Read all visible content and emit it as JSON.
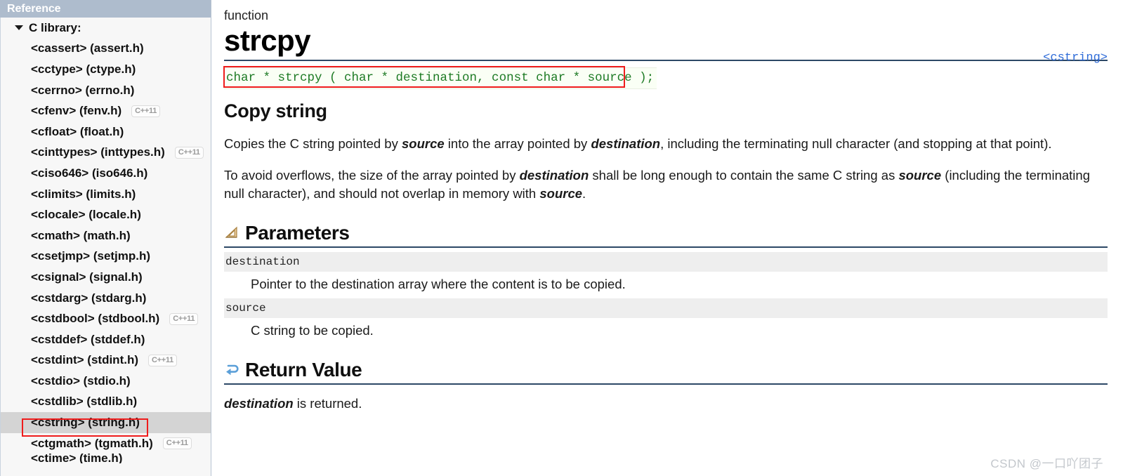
{
  "sidebar": {
    "header": "Reference",
    "annotation_color": "#ef1c1c",
    "selected_bg": "#d4d4d4",
    "header_bg": "#aebccd",
    "root": {
      "label": "C library:",
      "icon": "triangle-down-icon"
    },
    "items": [
      {
        "label": "<cassert> (assert.h)",
        "badge": "",
        "selected": false
      },
      {
        "label": "<cctype> (ctype.h)",
        "badge": "",
        "selected": false
      },
      {
        "label": "<cerrno> (errno.h)",
        "badge": "",
        "selected": false
      },
      {
        "label": "<cfenv> (fenv.h)",
        "badge": "C++11",
        "selected": false
      },
      {
        "label": "<cfloat> (float.h)",
        "badge": "",
        "selected": false
      },
      {
        "label": "<cinttypes> (inttypes.h)",
        "badge": "C++11",
        "selected": false
      },
      {
        "label": "<ciso646> (iso646.h)",
        "badge": "",
        "selected": false
      },
      {
        "label": "<climits> (limits.h)",
        "badge": "",
        "selected": false
      },
      {
        "label": "<clocale> (locale.h)",
        "badge": "",
        "selected": false
      },
      {
        "label": "<cmath> (math.h)",
        "badge": "",
        "selected": false
      },
      {
        "label": "<csetjmp> (setjmp.h)",
        "badge": "",
        "selected": false
      },
      {
        "label": "<csignal> (signal.h)",
        "badge": "",
        "selected": false
      },
      {
        "label": "<cstdarg> (stdarg.h)",
        "badge": "",
        "selected": false
      },
      {
        "label": "<cstdbool> (stdbool.h)",
        "badge": "C++11",
        "selected": false
      },
      {
        "label": "<cstddef> (stddef.h)",
        "badge": "",
        "selected": false
      },
      {
        "label": "<cstdint> (stdint.h)",
        "badge": "C++11",
        "selected": false
      },
      {
        "label": "<cstdio> (stdio.h)",
        "badge": "",
        "selected": false
      },
      {
        "label": "<cstdlib> (stdlib.h)",
        "badge": "",
        "selected": false
      },
      {
        "label": "<cstring> (string.h)",
        "badge": "",
        "selected": true
      },
      {
        "label": "<ctgmath> (tgmath.h)",
        "badge": "C++11",
        "selected": false
      },
      {
        "label": "<ctime> (time.h)",
        "badge": "",
        "selected": false
      }
    ]
  },
  "main": {
    "kind": "function",
    "title": "strcpy",
    "header_link": "<cstring>",
    "signature": "char * strcpy ( char * destination, const char * source );",
    "signature_color": "#1d7a24",
    "subtitle": "Copy string",
    "paragraph1": {
      "part1": "Copies the C string pointed by ",
      "em1": "source",
      "part2": " into the array pointed by ",
      "em2": "destination",
      "part3": ", including the terminating null character (and stopping at that point)."
    },
    "paragraph2": {
      "part1": "To avoid overflows, the size of the array pointed by ",
      "em1": "destination",
      "part2": " shall be long enough to contain the same C string as ",
      "em2": "source",
      "part3": " (including the terminating null character), and should not overlap in memory with ",
      "em3": "source",
      "part4": "."
    },
    "parameters_section": {
      "heading": "Parameters",
      "icon": "ruler-triangle-icon",
      "rows": [
        {
          "name": "destination",
          "desc": "Pointer to the destination array where the content is to be copied."
        },
        {
          "name": "source",
          "desc": "C string to be copied."
        }
      ]
    },
    "return_section": {
      "heading": "Return Value",
      "icon": "return-arrow-icon",
      "text": {
        "em1": "destination",
        "part1": " is returned."
      }
    }
  },
  "watermark": "CSDN @一口吖团子"
}
